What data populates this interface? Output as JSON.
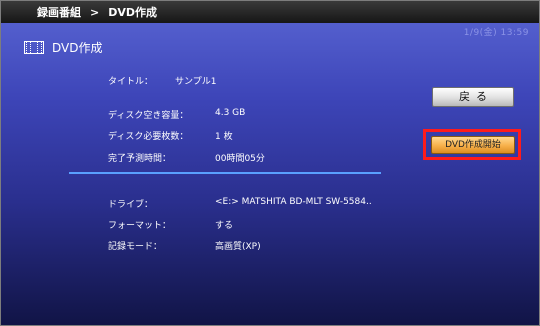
{
  "breadcrumb": {
    "root": "録画番組",
    "separator": ">",
    "current": "DVD作成"
  },
  "clock": "1/9(金) 13:59",
  "header": {
    "title": "DVD作成",
    "icon": "film-icon"
  },
  "info": {
    "title_label": "タイトル：",
    "title_value": "サンプル1",
    "free_space_label": "ディスク空き容量：",
    "free_space_value": "4.3 GB",
    "discs_label": "ディスク必要枚数：",
    "discs_value": "1 枚",
    "time_label": "完了予測時間：",
    "time_value": "00時間05分",
    "drive_label": "ドライブ：",
    "drive_value": "<E:> MATSHITA BD-MLT SW-5584..",
    "format_label": "フォーマット：",
    "format_value": "する",
    "mode_label": "記録モード：",
    "mode_value": "高画質(XP)"
  },
  "buttons": {
    "back": "戻る",
    "create": "DVD作成開始"
  },
  "colors": {
    "highlight": "#ff1b1b",
    "divider": "#5aa0ff",
    "create_button": "#f7b04a"
  }
}
